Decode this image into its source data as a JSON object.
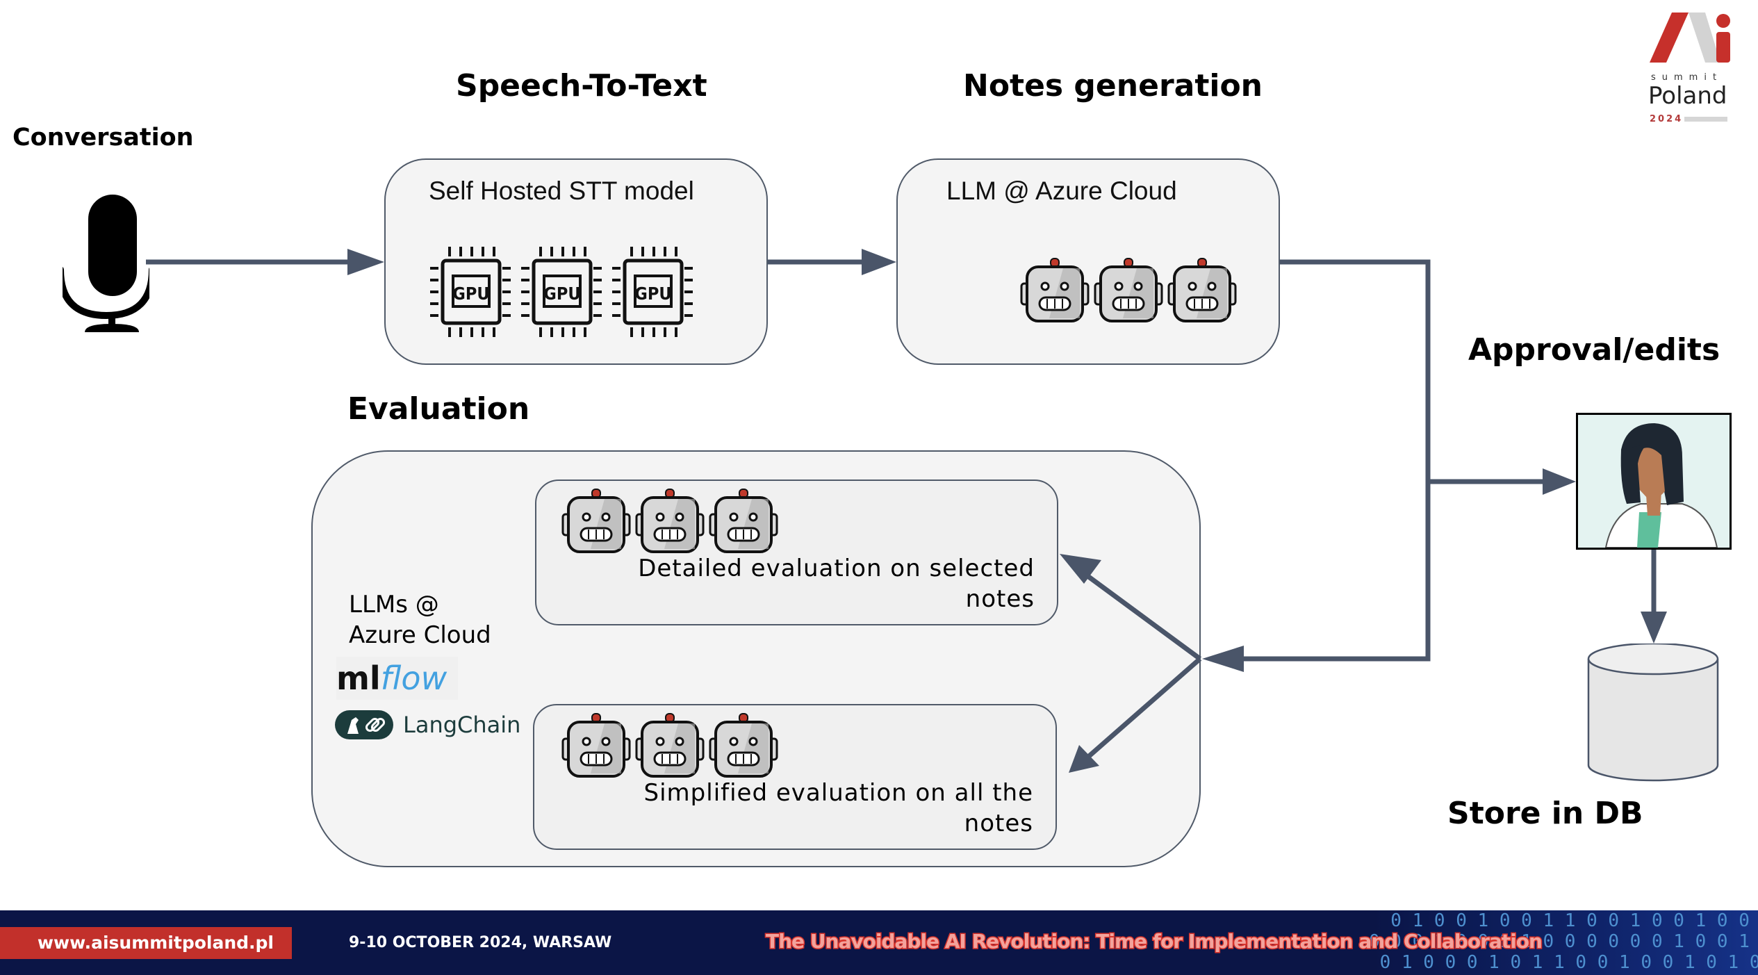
{
  "logo": {
    "brand": "Ai",
    "summit": "summit",
    "country": "Poland",
    "year": "2024"
  },
  "headings": {
    "conversation": "Conversation",
    "speech_to_text": "Speech-To-Text",
    "notes_generation": "Notes generation",
    "approval": "Approval/edits",
    "evaluation": "Evaluation",
    "store": "Store in DB"
  },
  "stt_box": {
    "title": "Self Hosted STT model",
    "chips": [
      "GPU",
      "GPU",
      "GPU"
    ]
  },
  "notes_box": {
    "title": "LLM @ Azure Cloud",
    "robots": 3
  },
  "evaluation": {
    "llms_label_line1": "LLMs @",
    "llms_label_line2": "Azure Cloud",
    "mlflow_ml": "ml",
    "mlflow_flow": "flow",
    "langchain": "LangChain",
    "detailed": {
      "line1": "Detailed evaluation on selected",
      "line2": "notes",
      "robots": 3
    },
    "simplified": {
      "line1": "Simplified evaluation on all the",
      "line2": "notes",
      "robots": 3
    }
  },
  "icons": {
    "microphone": "microphone-icon",
    "gpu": "gpu-chip-icon",
    "robot": "robot-icon",
    "doctor": "doctor-avatar",
    "database": "database-icon"
  },
  "colors": {
    "arrow": "#4a5569",
    "box_fill": "#f4f4f4",
    "box_stroke": "#505a69",
    "footer_bg": "#0b1546",
    "accent_red": "#c2302b"
  },
  "footer": {
    "url": "www.aisummitpoland.pl",
    "date": "9-10 OCTOBER 2024, WARSAW",
    "tagline": "The Unavoidable AI Revolution: Time for Implementation and Collaboration"
  }
}
